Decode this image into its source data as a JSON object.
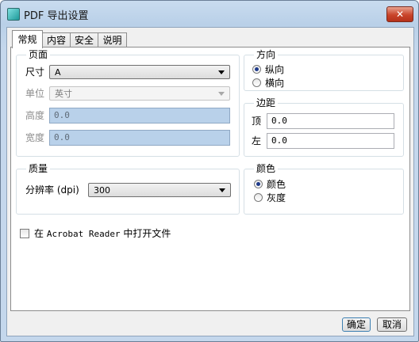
{
  "window": {
    "title": "PDF 导出设置",
    "close_label": "✕"
  },
  "tabs": [
    {
      "label": "常规"
    },
    {
      "label": "内容"
    },
    {
      "label": "安全"
    },
    {
      "label": "说明"
    }
  ],
  "page": {
    "group_label": "页面",
    "size_label": "尺寸",
    "size_value": "A",
    "unit_label": "单位",
    "unit_value": "英寸",
    "height_label": "高度",
    "height_value": "0.0",
    "width_label": "宽度",
    "width_value": "0.0"
  },
  "orientation": {
    "group_label": "方向",
    "options": [
      {
        "label": "纵向",
        "checked": true
      },
      {
        "label": "横向",
        "checked": false
      }
    ]
  },
  "margin": {
    "group_label": "边距",
    "top_label": "顶",
    "top_value": "0.0",
    "left_label": "左",
    "left_value": "0.0"
  },
  "quality": {
    "group_label": "质量",
    "resolution_label": "分辨率 (dpi)",
    "resolution_value": "300"
  },
  "color": {
    "group_label": "颜色",
    "options": [
      {
        "label": "颜色",
        "checked": true
      },
      {
        "label": "灰度",
        "checked": false
      }
    ]
  },
  "open_in_reader": {
    "prefix": "在",
    "app": "Acrobat Reader",
    "suffix": "中打开文件",
    "checked": false
  },
  "buttons": {
    "ok": "确定",
    "cancel": "取消"
  }
}
